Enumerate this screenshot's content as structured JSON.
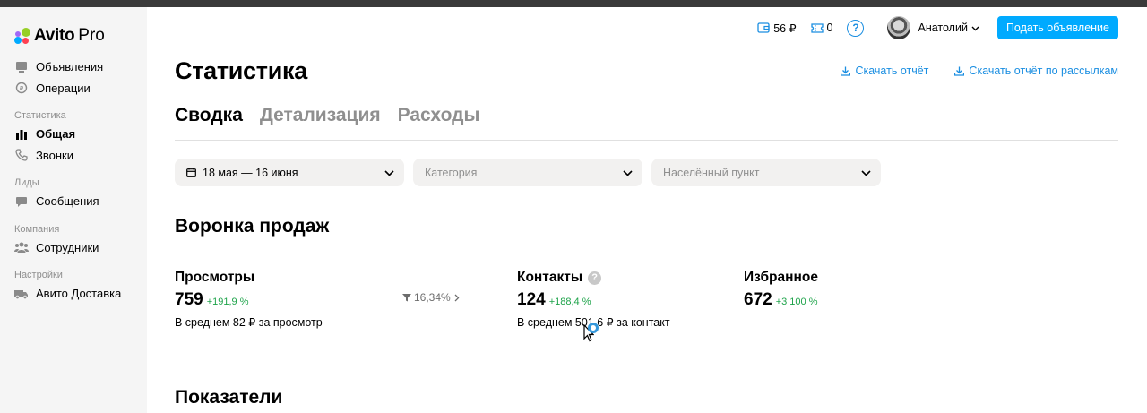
{
  "app": {
    "logo_text": "Avito",
    "logo_suffix": "Pro"
  },
  "sidebar": {
    "items_top": [
      {
        "label": "Объявления",
        "icon": "listing-icon"
      },
      {
        "label": "Операции",
        "icon": "operations-icon"
      }
    ],
    "sections": [
      {
        "title": "Статистика",
        "items": [
          {
            "label": "Общая",
            "icon": "bar-chart-icon",
            "active": true
          },
          {
            "label": "Звонки",
            "icon": "phone-icon"
          }
        ]
      },
      {
        "title": "Лиды",
        "items": [
          {
            "label": "Сообщения",
            "icon": "chat-icon"
          }
        ]
      },
      {
        "title": "Компания",
        "items": [
          {
            "label": "Сотрудники",
            "icon": "users-icon"
          }
        ]
      },
      {
        "title": "Настройки",
        "items": [
          {
            "label": "Авито Доставка",
            "icon": "truck-icon"
          }
        ]
      }
    ]
  },
  "header": {
    "wallet": "56 ₽",
    "bonus": "0",
    "help": "?",
    "user_name": "Анатолий",
    "post_button": "Подать объявление"
  },
  "page": {
    "title": "Статистика",
    "download_report": "Скачать отчёт",
    "download_mailing_report": "Скачать отчёт по рассылкам",
    "tabs": [
      {
        "label": "Сводка",
        "active": true
      },
      {
        "label": "Детализация"
      },
      {
        "label": "Расходы"
      }
    ]
  },
  "filters": {
    "date": "18 мая — 16 июня",
    "category_placeholder": "Категория",
    "location_placeholder": "Населённый пункт"
  },
  "funnel": {
    "title": "Воронка продаж",
    "views": {
      "label": "Просмотры",
      "value": "759",
      "delta": "+191,9 %",
      "avg": "В среднем 82 ₽ за просмотр"
    },
    "conversion": "16,34%",
    "contacts": {
      "label": "Контакты",
      "value": "124",
      "delta": "+188,4 %",
      "avg": "В среднем 501,6 ₽ за контакт"
    },
    "favorites": {
      "label": "Избранное",
      "value": "672",
      "delta": "+3 100 %"
    }
  },
  "indicators": {
    "title": "Показатели"
  },
  "colors": {
    "accent": "#00aaff",
    "link": "#1a8ee1",
    "positive": "#1ea34a",
    "sidebar_bg": "#f5f5f5"
  }
}
